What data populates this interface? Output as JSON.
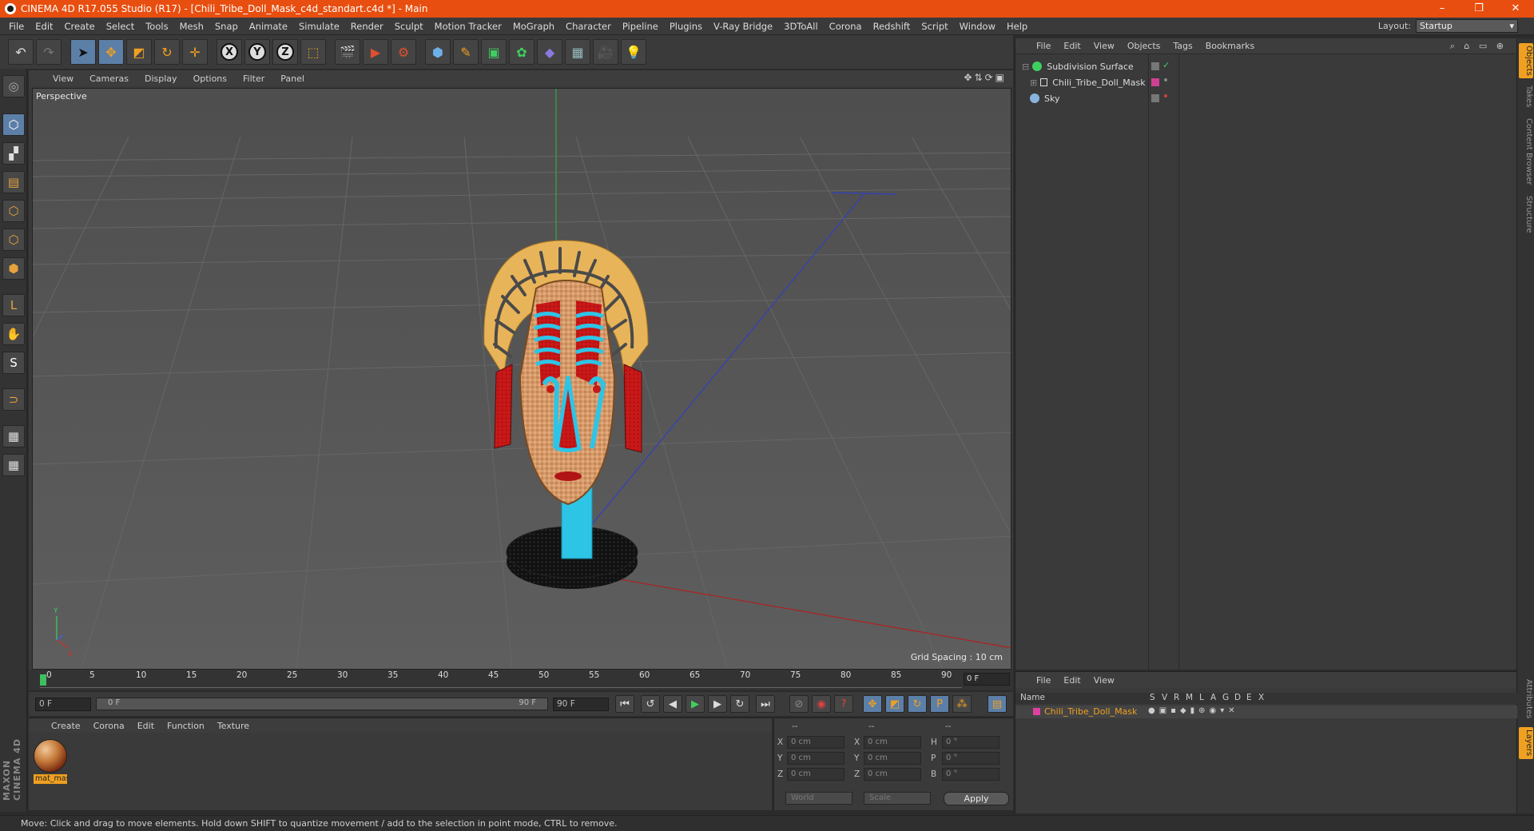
{
  "window": {
    "title": "CINEMA 4D R17.055 Studio (R17) - [Chili_Tribe_Doll_Mask_c4d_standart.c4d *] - Main",
    "controls": [
      "–",
      "❐",
      "✕"
    ]
  },
  "menubar": {
    "items": [
      "File",
      "Edit",
      "Create",
      "Select",
      "Tools",
      "Mesh",
      "Snap",
      "Animate",
      "Simulate",
      "Render",
      "Sculpt",
      "Motion Tracker",
      "MoGraph",
      "Character",
      "Pipeline",
      "Plugins",
      "V-Ray Bridge",
      "3DToAll",
      "Corona",
      "Redshift",
      "Script",
      "Window",
      "Help"
    ],
    "layout_label": "Layout:",
    "layout_value": "Startup"
  },
  "toolbar": {
    "icons": [
      "undo-icon",
      "redo-icon",
      "select-arrow-icon",
      "move-icon",
      "scale-icon",
      "rotate-icon",
      "move-all-icon",
      "x-axis-icon",
      "y-axis-icon",
      "z-axis-icon",
      "coord-system-icon",
      "render-view-icon",
      "render-picture-queue-icon",
      "edit-render-settings-icon",
      "cube-icon",
      "pen-icon",
      "subdivision-icon",
      "cloner-icon",
      "deformer-icon",
      "floor-icon",
      "camera-icon",
      "light-icon"
    ],
    "axis_labels": [
      "X",
      "Y",
      "Z"
    ]
  },
  "viewport": {
    "menu": [
      "View",
      "Cameras",
      "Display",
      "Options",
      "Filter",
      "Panel"
    ],
    "label": "Perspective",
    "grid_spacing": "Grid Spacing : 10 cm",
    "axis_y": "Y",
    "axis_x": "X"
  },
  "timeline": {
    "ticks": [
      "0",
      "5",
      "10",
      "15",
      "20",
      "25",
      "30",
      "35",
      "40",
      "45",
      "50",
      "55",
      "60",
      "65",
      "70",
      "75",
      "80",
      "85",
      "90"
    ],
    "current_frame": "0 F"
  },
  "transport": {
    "start": "0 F",
    "range_start": "0 F",
    "range_end": "90 F",
    "end": "90 F"
  },
  "material_manager": {
    "menu": [
      "Create",
      "Corona",
      "Edit",
      "Function",
      "Texture"
    ],
    "materials": [
      {
        "name": "mat_mas"
      }
    ]
  },
  "coordinates": {
    "headers": [
      "--",
      "--",
      "--"
    ],
    "rows": [
      {
        "l1": "X",
        "v1": "0 cm",
        "l2": "X",
        "v2": "0 cm",
        "l3": "H",
        "v3": "0 °"
      },
      {
        "l1": "Y",
        "v1": "0 cm",
        "l2": "Y",
        "v2": "0 cm",
        "l3": "P",
        "v3": "0 °"
      },
      {
        "l1": "Z",
        "v1": "0 cm",
        "l2": "Z",
        "v2": "0 cm",
        "l3": "B",
        "v3": "0 °"
      }
    ],
    "space": "World",
    "mode": "Scale",
    "apply": "Apply"
  },
  "object_manager": {
    "menu": [
      "File",
      "Edit",
      "View",
      "Objects",
      "Tags",
      "Bookmarks"
    ],
    "objects": [
      {
        "name": "Subdivision Surface",
        "color": "#3fcf5f"
      },
      {
        "name": "Chili_Tribe_Doll_Mask",
        "color": "#cfcfcf"
      },
      {
        "name": "Sky",
        "color": "#8ab4e0"
      }
    ]
  },
  "right_tabs": [
    "Objects",
    "Takes",
    "Content Browser",
    "Structure",
    "Attributes",
    "Layers"
  ],
  "layer_manager": {
    "menu": [
      "File",
      "Edit",
      "View"
    ],
    "columns": [
      "Name",
      "S",
      "V",
      "R",
      "M",
      "L",
      "A",
      "G",
      "D",
      "E",
      "X"
    ],
    "layers": [
      {
        "name": "Chili_Tribe_Doll_Mask",
        "color": "#e040a0"
      }
    ]
  },
  "status": "Move: Click and drag to move elements. Hold down SHIFT to quantize movement / add to the selection in point mode, CTRL to remove.",
  "brand": "MAXON CINEMA 4D",
  "colors": {
    "accent": "#e84e0f",
    "selection": "#f0a020",
    "active_tool": "#5c7fa8"
  }
}
